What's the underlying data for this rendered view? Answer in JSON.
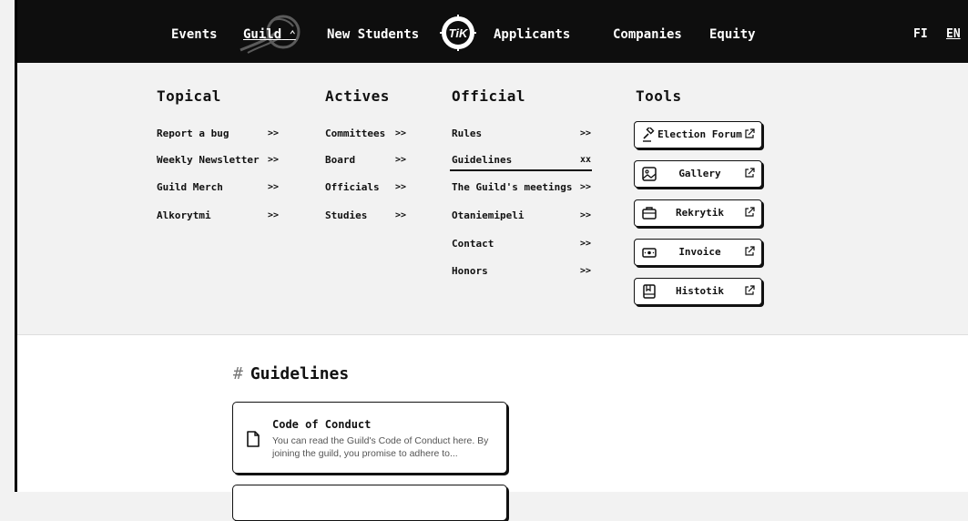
{
  "nav": {
    "items": [
      {
        "label": "Events"
      },
      {
        "label": "Guild"
      },
      {
        "label": "New Students"
      },
      {
        "label": "Applicants"
      },
      {
        "label": "Companies"
      },
      {
        "label": "Equity"
      }
    ],
    "guild_chevron": "⌃",
    "logo_icon": "tik-logo-icon",
    "languages": [
      "FI",
      "EN"
    ],
    "active_language": "EN"
  },
  "menu": {
    "columns": [
      {
        "title": "Topical",
        "links": [
          {
            "label": "Report a bug",
            "arrow": ">>"
          },
          {
            "label": "Weekly Newsletter",
            "arrow": ">>"
          },
          {
            "label": "Guild Merch",
            "arrow": ">>"
          },
          {
            "label": "Alkorytmi",
            "arrow": ">>"
          }
        ]
      },
      {
        "title": "Actives",
        "links": [
          {
            "label": "Committees",
            "arrow": ">>"
          },
          {
            "label": "Board",
            "arrow": ">>"
          },
          {
            "label": "Officials",
            "arrow": ">>"
          },
          {
            "label": "Studies",
            "arrow": ">>"
          }
        ]
      },
      {
        "title": "Official",
        "links": [
          {
            "label": "Rules",
            "arrow": ">>"
          },
          {
            "label": "Guidelines",
            "arrow": "xx",
            "active": true
          },
          {
            "label": "The Guild's meetings",
            "arrow": ">>"
          },
          {
            "label": "Otaniemipeli",
            "arrow": ">>"
          },
          {
            "label": "Contact",
            "arrow": ">>"
          },
          {
            "label": "Honors",
            "arrow": ">>"
          }
        ]
      },
      {
        "title": "Tools",
        "tools": [
          {
            "label": "Election Forum",
            "icon": "gavel-icon"
          },
          {
            "label": "Gallery",
            "icon": "image-icon"
          },
          {
            "label": "Rekrytik",
            "icon": "briefcase-icon"
          },
          {
            "label": "Invoice",
            "icon": "money-icon"
          },
          {
            "label": "Histotik",
            "icon": "book-icon"
          }
        ]
      }
    ]
  },
  "content": {
    "heading_hash": "#",
    "heading": "Guidelines",
    "cards": [
      {
        "title": "Code of Conduct",
        "description": "You can read the Guild's Code of Conduct here. By joining the guild, you promise to adhere to...",
        "icon": "document-icon"
      }
    ]
  }
}
